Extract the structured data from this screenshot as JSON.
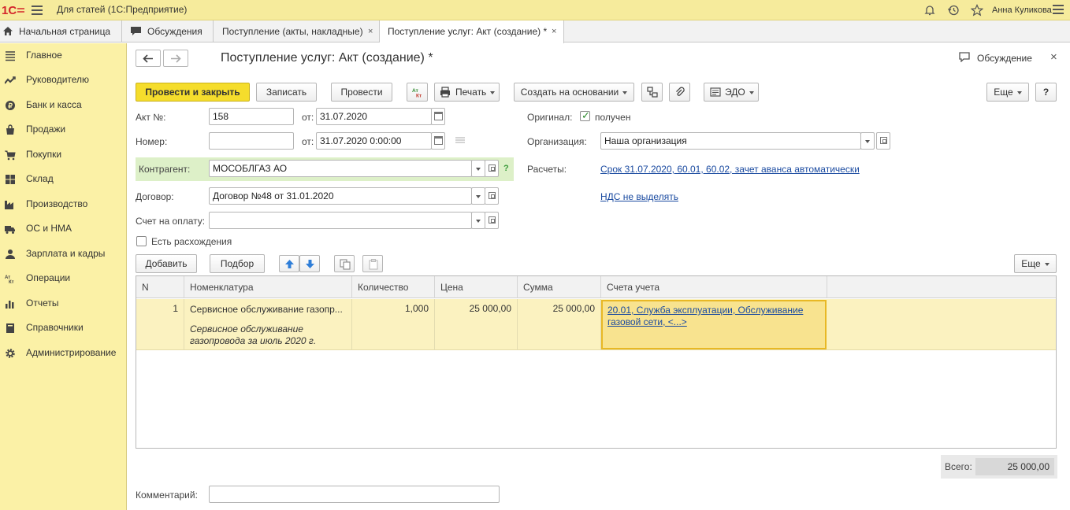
{
  "app": {
    "title": "Для статей   (1С:Предприятие)",
    "user": "Анна Куликова"
  },
  "tabs": [
    {
      "label": "Начальная страница",
      "close": ""
    },
    {
      "label": "Обсуждения",
      "close": ""
    },
    {
      "label": "Поступление (акты, накладные)",
      "close": "×"
    },
    {
      "label": "Поступление услуг: Акт (создание) *",
      "close": "×"
    }
  ],
  "sidebar": {
    "items": [
      {
        "label": "Главное",
        "icon": "menu-lines-icon"
      },
      {
        "label": "Руководителю",
        "icon": "trend-icon"
      },
      {
        "label": "Банк и касса",
        "icon": "coin-icon"
      },
      {
        "label": "Продажи",
        "icon": "bag-icon"
      },
      {
        "label": "Покупки",
        "icon": "cart-icon"
      },
      {
        "label": "Склад",
        "icon": "warehouse-icon"
      },
      {
        "label": "Производство",
        "icon": "factory-icon"
      },
      {
        "label": "ОС и НМА",
        "icon": "truck-icon"
      },
      {
        "label": "Зарплата и кадры",
        "icon": "person-icon"
      },
      {
        "label": "Операции",
        "icon": "dt-kt-icon"
      },
      {
        "label": "Отчеты",
        "icon": "bar-chart-icon"
      },
      {
        "label": "Справочники",
        "icon": "book-icon"
      },
      {
        "label": "Администрирование",
        "icon": "gear-icon"
      }
    ]
  },
  "form": {
    "title": "Поступление услуг: Акт (создание) *",
    "discuss_label": "Обсуждение",
    "close": "×",
    "toolbar": {
      "post_close": "Провести и закрыть",
      "save": "Записать",
      "post": "Провести",
      "print": "Печать",
      "create_based": "Создать на основании",
      "edo": "ЭДО",
      "more": "Еще",
      "help": "?"
    },
    "fields": {
      "act_no_label": "Акт №:",
      "act_no": "158",
      "from_label": "от:",
      "act_date": "31.07.2020",
      "number_label": "Номер:",
      "number": "",
      "number_date": "31.07.2020  0:00:00",
      "contractor_label": "Контрагент:",
      "contractor": "МОСОБЛГАЗ АО",
      "contract_label": "Договор:",
      "contract": "Договор №48 от 31.01.2020",
      "invoice_label": "Счет на оплату:",
      "invoice": "",
      "discrepancy_label": "Есть расхождения",
      "original_label": "Оригинал:",
      "original_value": "получен",
      "org_label": "Организация:",
      "org": "Наша организация",
      "settlements_label": "Расчеты:",
      "settlements_link": "Срок 31.07.2020, 60.01, 60.02, зачет аванса автоматически",
      "vat_link": "НДС не выделять",
      "comment_label": "Комментарий:",
      "comment": ""
    },
    "table_toolbar": {
      "add": "Добавить",
      "pick": "Подбор",
      "more": "Еще"
    },
    "table": {
      "columns": [
        "N",
        "Номенклатура",
        "Количество",
        "Цена",
        "Сумма",
        "Счета учета"
      ],
      "rows": [
        {
          "n": "1",
          "nomenclature": "Сервисное обслуживание газопр...",
          "content": "Сервисное обслуживание газопровода за июль 2020 г.",
          "qty": "1,000",
          "price": "25 000,00",
          "sum": "25 000,00",
          "accounts": "20.01, Служба эксплуатации, Обслуживание газовой сети, <...>"
        }
      ]
    },
    "total_label": "Всего:",
    "total_value": "25 000,00"
  }
}
